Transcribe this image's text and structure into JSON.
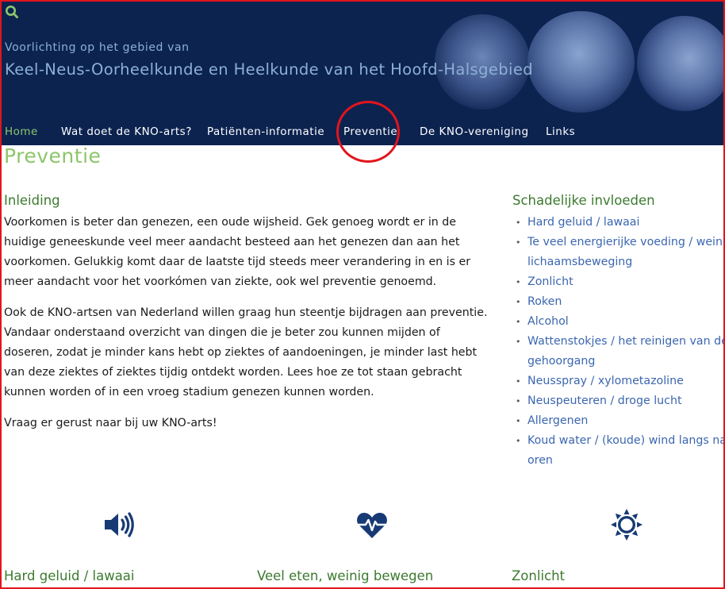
{
  "header": {
    "subtitle": "Voorlichting op het gebied van",
    "title": "Keel-Neus-Oorheelkunde en Heelkunde van het Hoofd-Halsgebied"
  },
  "nav": {
    "items": [
      {
        "label": "Home"
      },
      {
        "label": "Wat doet de KNO-arts?"
      },
      {
        "label": "Patiënten-informatie"
      },
      {
        "label": "Preventie"
      },
      {
        "label": "De KNO-vereniging"
      },
      {
        "label": "Links"
      }
    ]
  },
  "page": {
    "title": "Preventie",
    "intro_heading": "Inleiding",
    "paragraphs": [
      "Voorkomen is beter dan genezen, een oude wijsheid. Gek genoeg wordt er in de huidige geneeskunde veel meer aandacht besteed aan het genezen dan aan het voorkomen. Gelukkig komt daar de laatste tijd steeds meer verandering in en is er meer aandacht voor het voorkómen van ziekte, ook wel preventie genoemd.",
      "Ook de KNO-artsen van Nederland willen graag hun steentje bijdragen aan preventie. Vandaar onderstaand overzicht van dingen die je beter zou kunnen mijden of doseren, zodat je minder kans hebt op ziektes of aandoeningen, je minder last hebt van deze ziektes of ziektes tijdig ontdekt worden. Lees hoe ze tot staan gebracht kunnen worden of in een vroeg stadium genezen kunnen worden.",
      "Vraag er gerust naar bij uw KNO-arts!"
    ]
  },
  "sidebar": {
    "heading": "Schadelijke invloeden",
    "items": [
      {
        "lines": [
          "Hard geluid / lawaai"
        ]
      },
      {
        "lines": [
          "Te veel energierijke voeding / weinig",
          "lichaamsbeweging"
        ]
      },
      {
        "lines": [
          "Zonlicht"
        ]
      },
      {
        "lines": [
          "Roken"
        ]
      },
      {
        "lines": [
          "Alcohol"
        ]
      },
      {
        "lines": [
          "Wattenstokjes / het reinigen van de",
          "gehoorgang"
        ]
      },
      {
        "lines": [
          "Neusspray / xylometazoline"
        ]
      },
      {
        "lines": [
          "Neuspeuteren / droge lucht"
        ]
      },
      {
        "lines": [
          "Allergenen"
        ]
      },
      {
        "lines": [
          "Koud water / (koude) wind langs natte",
          "oren"
        ]
      }
    ]
  },
  "features": [
    {
      "title": "Hard geluid / lawaai",
      "icon": "speaker-icon"
    },
    {
      "title": "Veel eten, weinig bewegen",
      "icon": "heartbeat-icon"
    },
    {
      "title": "Zonlicht",
      "icon": "sun-icon"
    }
  ],
  "colors": {
    "header_bg": "#0c2350",
    "accent_green": "#8cc66a",
    "heading_green": "#3c7a2e",
    "link_blue": "#3b66b0",
    "icon_navy": "#173a75",
    "annotation_red": "#e3141c"
  }
}
